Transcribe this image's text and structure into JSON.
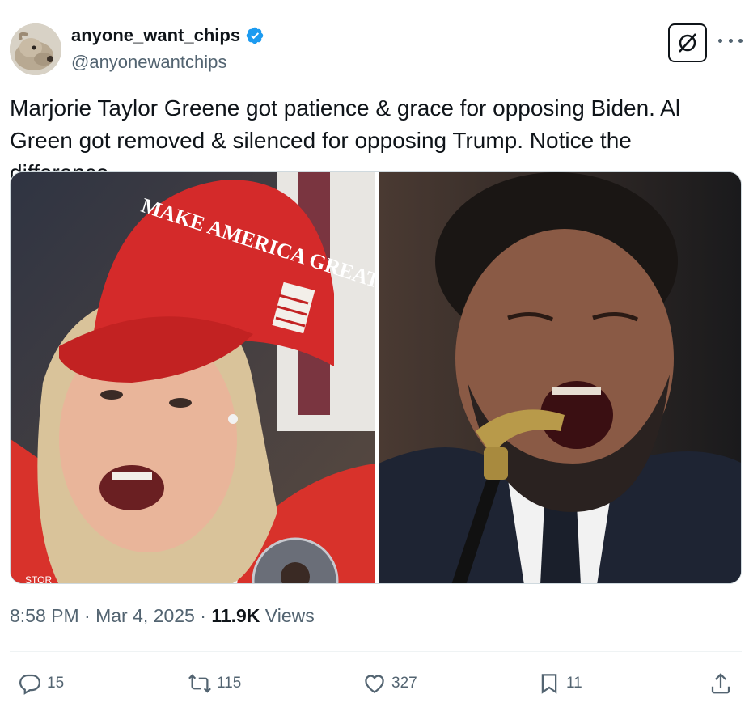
{
  "author": {
    "display_name": "anyone_want_chips",
    "handle": "@anyonewantchips",
    "verified_icon": "verified-badge-icon",
    "avatar_icon": "dog-avatar"
  },
  "tweet": {
    "text": "Marjorie Taylor Greene got patience & grace for opposing Biden. Al Green got removed & silenced for opposing Trump. Notice the difference.",
    "images": [
      {
        "caption": "MAKE AMERICA GREAT AGAIN",
        "corner_text": "STOR"
      },
      {
        "caption": ""
      }
    ]
  },
  "meta": {
    "time": "8:58 PM",
    "separator1": " · ",
    "date": "Mar 4, 2025",
    "separator2": " · ",
    "views_count": "11.9K",
    "views_label": " Views"
  },
  "actions": {
    "replies": "15",
    "reposts": "115",
    "likes": "327",
    "bookmarks": "11"
  },
  "colors": {
    "text_primary": "#0f1419",
    "text_secondary": "#536471",
    "verified": "#1d9bf0",
    "hat_red": "#d42a2a",
    "divider": "#eff3f4"
  }
}
